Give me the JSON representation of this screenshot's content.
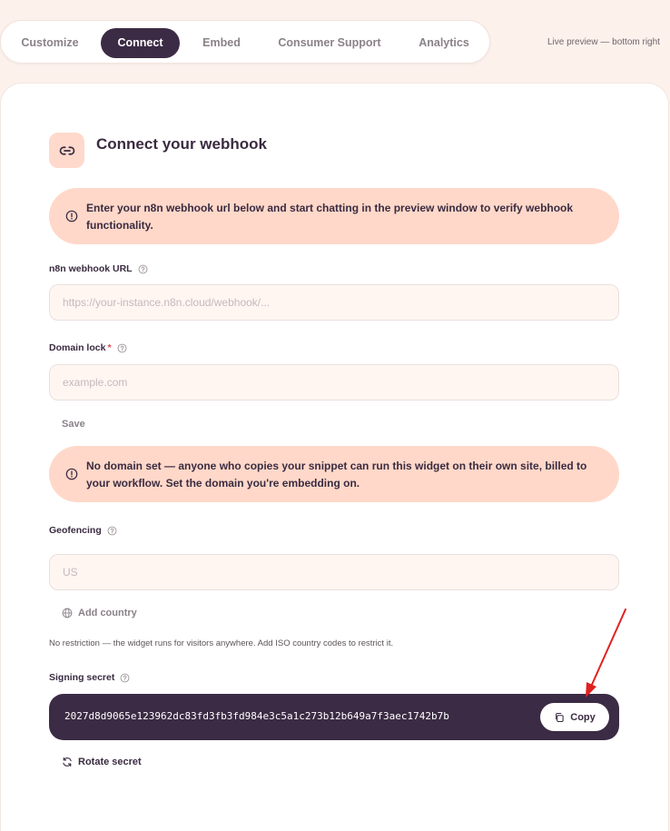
{
  "tabs": [
    {
      "label": "Customize",
      "active": false
    },
    {
      "label": "Connect",
      "active": true
    },
    {
      "label": "Embed",
      "active": false
    },
    {
      "label": "Consumer Support",
      "active": false
    },
    {
      "label": "Analytics",
      "active": false
    }
  ],
  "preview_note": "Live preview — bottom right",
  "header": {
    "title": "Connect your webhook",
    "icon": "link-icon"
  },
  "webhook_alert": "Enter your n8n webhook url below and start chatting in the preview window to verify webhook functionality.",
  "webhook": {
    "label": "n8n webhook URL",
    "placeholder": "https://your-instance.n8n.cloud/webhook/...",
    "value": ""
  },
  "domain": {
    "label": "Domain lock",
    "required_mark": "*",
    "placeholder": "example.com",
    "value": "",
    "save_label": "Save"
  },
  "domain_alert": "No domain set — anyone who copies your snippet can run this widget on their own site, billed to your workflow. Set the domain you're embedding on.",
  "geofencing": {
    "label": "Geofencing",
    "placeholder": "US",
    "value": "",
    "add_country_label": "Add country",
    "hint": "No restriction — the widget runs for visitors anywhere. Add ISO country codes to restrict it."
  },
  "signing_secret": {
    "label": "Signing secret",
    "value": "2027d8d9065e123962dc83fd3fb3fd984e3c5a1c273b12b649a7f3aec1742b7b",
    "copy_label": "Copy",
    "rotate_label": "Rotate secret"
  },
  "colors": {
    "accent_dark": "#3b2b44",
    "alert_bg": "#ffd8c9",
    "page_bg": "#fdf1ec",
    "annotation_arrow": "#e02020"
  }
}
